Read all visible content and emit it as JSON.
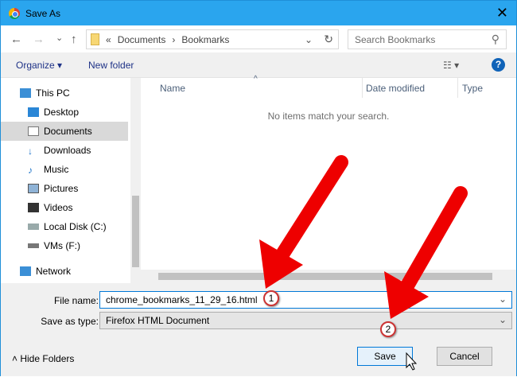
{
  "window": {
    "title": "Save As",
    "close": "✕"
  },
  "address": {
    "back": "←",
    "forward": "→",
    "recent": "⌄",
    "up": "↑",
    "crumbs": [
      "«",
      "Documents",
      "›",
      "Bookmarks"
    ],
    "refresh": "↻",
    "search_placeholder": "Search Bookmarks",
    "search_icon": "⚲"
  },
  "toolbar": {
    "organize": "Organize ▾",
    "new_folder": "New folder",
    "view": "☷ ▾",
    "help": "?"
  },
  "sidebar": {
    "items": [
      {
        "label": "This PC",
        "icon": "computer-icon"
      },
      {
        "label": "Desktop",
        "icon": "desktop-icon"
      },
      {
        "label": "Documents",
        "icon": "documents-icon",
        "selected": true
      },
      {
        "label": "Downloads",
        "icon": "downloads-icon"
      },
      {
        "label": "Music",
        "icon": "music-icon"
      },
      {
        "label": "Pictures",
        "icon": "pictures-icon"
      },
      {
        "label": "Videos",
        "icon": "videos-icon"
      },
      {
        "label": "Local Disk (C:)",
        "icon": "disk-icon"
      },
      {
        "label": "VMs (F:)",
        "icon": "drive-icon"
      },
      {
        "label": "Network",
        "icon": "network-icon"
      }
    ]
  },
  "list": {
    "columns": [
      "Name",
      "Date modified",
      "Type"
    ],
    "empty": "No items match your search."
  },
  "form": {
    "file_name_label": "File name:",
    "file_name": "chrome_bookmarks_11_29_16.html",
    "type_label": "Save as type:",
    "type_value": "Firefox HTML Document"
  },
  "buttons": {
    "hide_folders": "Hide Folders",
    "save": "Save",
    "cancel": "Cancel"
  },
  "annotations": {
    "step1": "1",
    "step2": "2"
  },
  "colors": {
    "titlebar": "#2aa5ee",
    "arrow": "#ee0000"
  }
}
